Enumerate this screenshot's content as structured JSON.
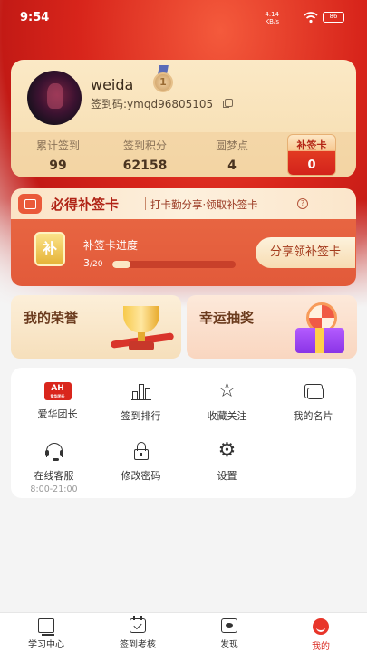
{
  "status_bar": {
    "time": "9:54",
    "network_speed": "4.14",
    "network_unit": "KB/s",
    "battery": "86"
  },
  "profile": {
    "username": "weida",
    "medal_level": "1",
    "sign_code": "签到码:ymqd96805105",
    "stats": [
      {
        "label": "累计签到",
        "value": "99"
      },
      {
        "label": "签到积分",
        "value": "62158"
      },
      {
        "label": "圆梦点",
        "value": "4"
      }
    ],
    "makeup_card": {
      "label": "补签卡",
      "value": "0"
    }
  },
  "makeup_banner": {
    "title": "必得补签卡",
    "subtitle": "打卡勤分享·领取补签卡",
    "icon_char": "补",
    "progress_label": "补签卡进度",
    "progress_current": "3",
    "progress_total": "/20",
    "progress_fraction": 0.15,
    "share_button": "分享领补签卡"
  },
  "tiles": {
    "honor": "我的荣誉",
    "lottery": "幸运抽奖"
  },
  "menu": [
    {
      "label": "爱华团长",
      "icon": "aihua-logo-icon"
    },
    {
      "label": "签到排行",
      "icon": "ranking-icon"
    },
    {
      "label": "收藏关注",
      "icon": "star-icon"
    },
    {
      "label": "我的名片",
      "icon": "card-folder-icon"
    },
    {
      "label": "在线客服",
      "sub": "8:00-21:00",
      "icon": "headset-icon"
    },
    {
      "label": "修改密码",
      "icon": "lock-icon"
    },
    {
      "label": "设置",
      "icon": "gear-icon"
    }
  ],
  "aihua_logo": {
    "mark": "AH",
    "caption": "爱华团长"
  },
  "bottom_nav": [
    {
      "label": "学习中心",
      "icon": "book-icon"
    },
    {
      "label": "签到考核",
      "icon": "calendar-check-icon"
    },
    {
      "label": "发现",
      "icon": "chat-icon"
    },
    {
      "label": "我的",
      "icon": "profile-icon",
      "active": true
    }
  ],
  "colors": {
    "accent_red": "#d9261c",
    "gold": "#f6dcae",
    "banner_orange": "#e25a3a"
  }
}
